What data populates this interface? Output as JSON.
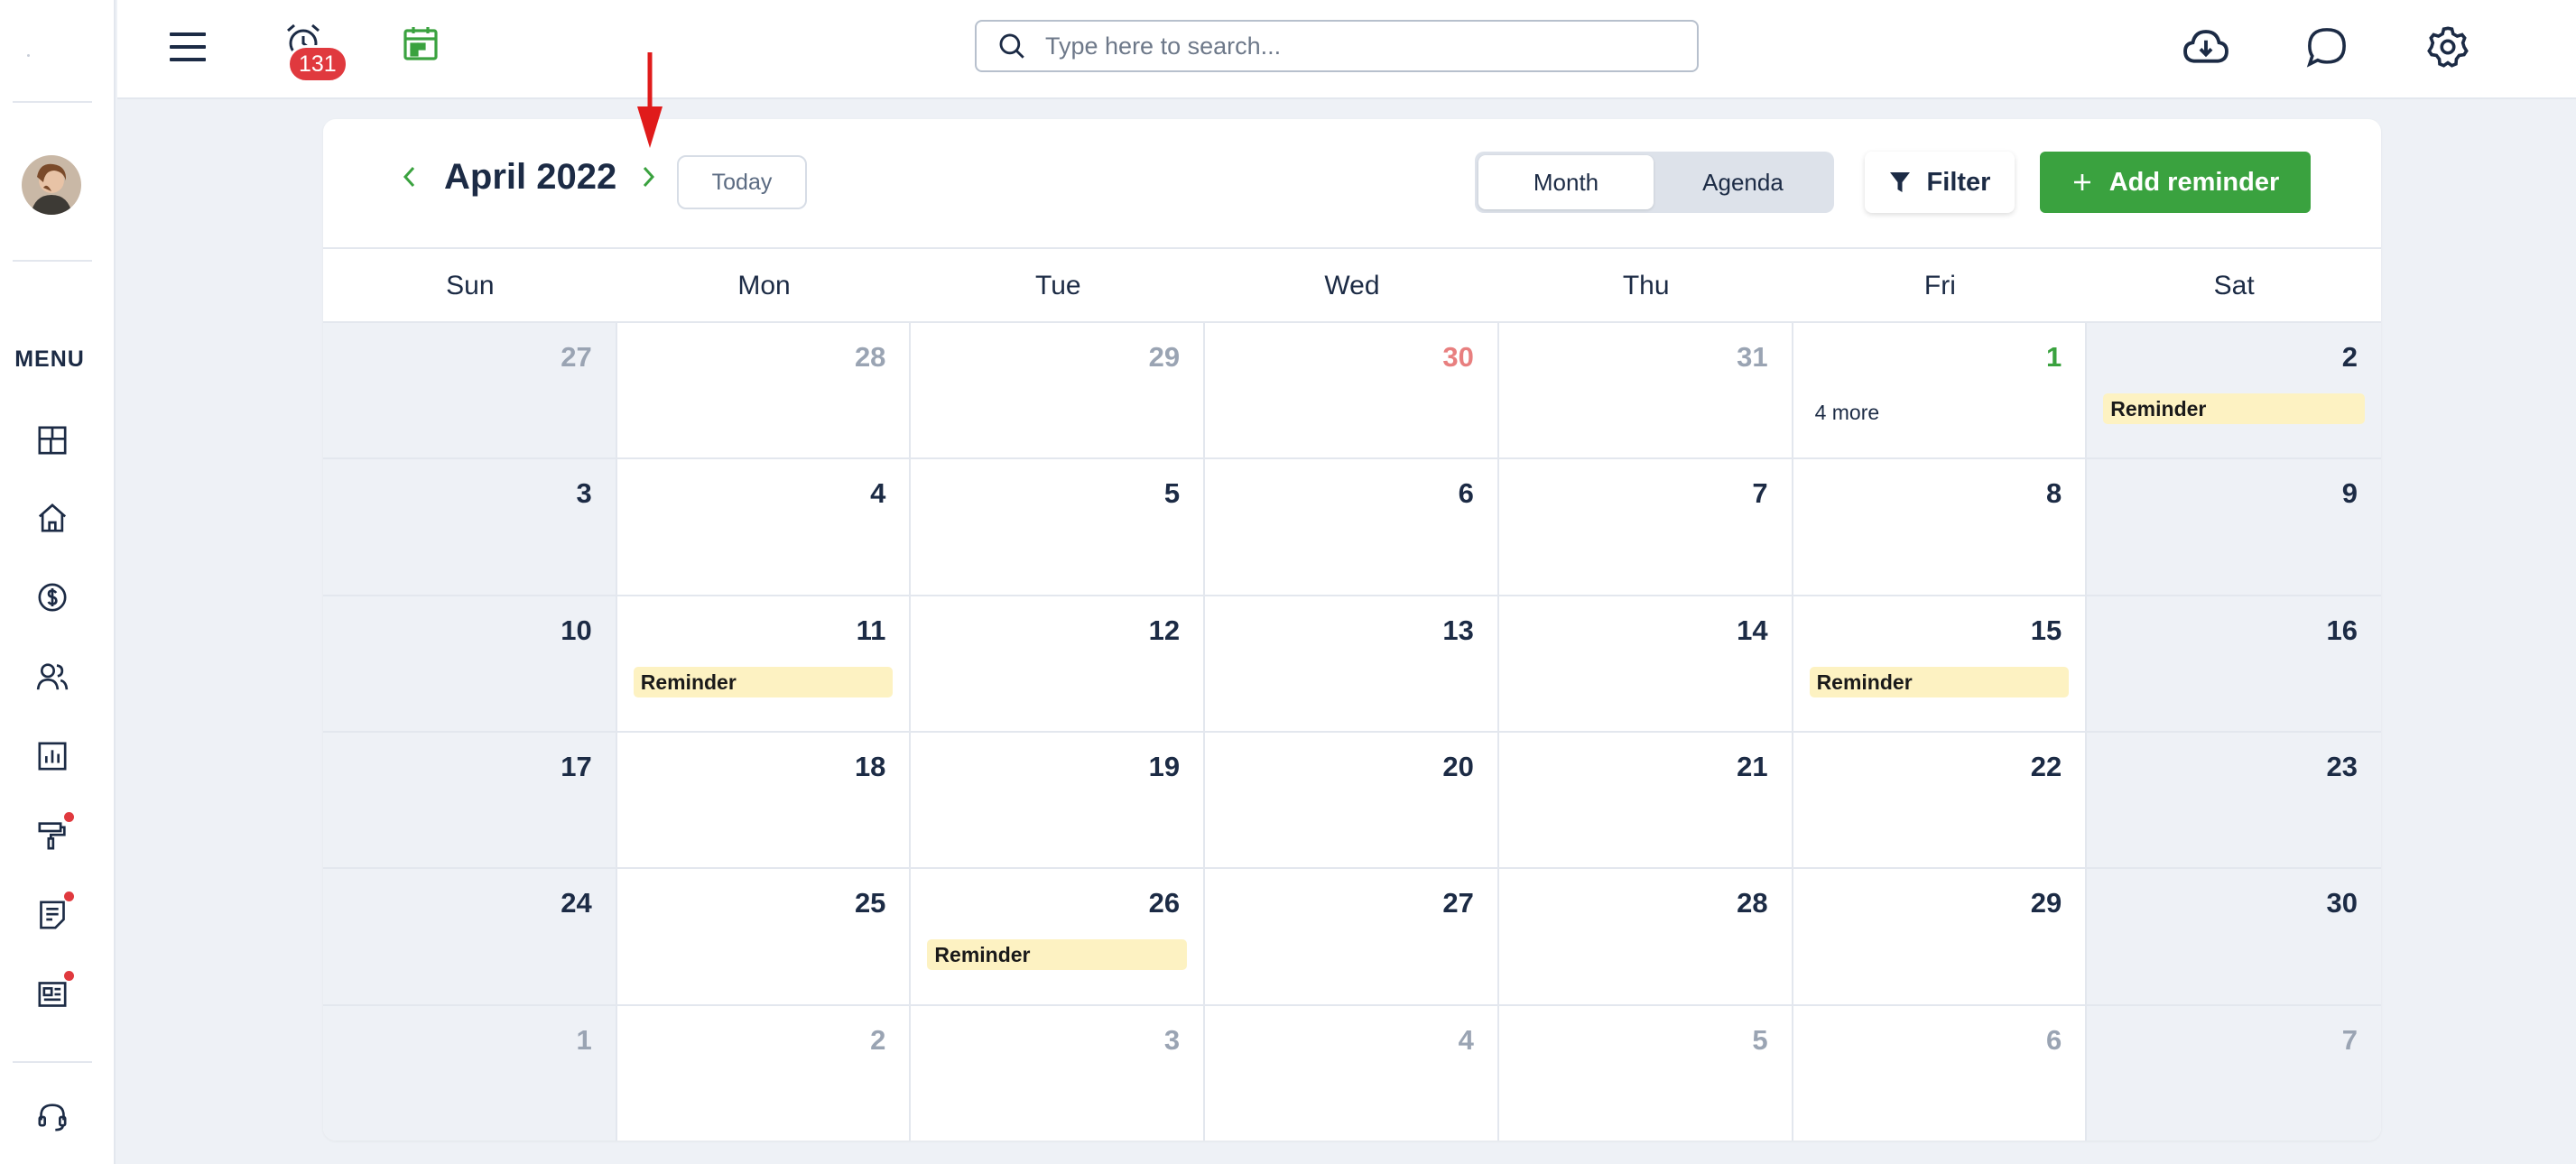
{
  "sidebar": {
    "menu_label": "MENU",
    "items": [
      {
        "name": "dashboard",
        "icon": "dashboard-icon"
      },
      {
        "name": "home",
        "icon": "home-icon"
      },
      {
        "name": "billing",
        "icon": "dollar-icon"
      },
      {
        "name": "clients",
        "icon": "users-icon"
      },
      {
        "name": "reports",
        "icon": "chart-icon"
      },
      {
        "name": "tools",
        "icon": "paint-roller-icon",
        "dot": true
      },
      {
        "name": "documents",
        "icon": "document-icon",
        "dot": true
      },
      {
        "name": "news",
        "icon": "newspaper-icon",
        "dot": true
      },
      {
        "name": "support",
        "icon": "headset-icon"
      }
    ]
  },
  "topbar": {
    "alarm_count": "131",
    "search_placeholder": "Type here to search..."
  },
  "calendar": {
    "month_title": "April 2022",
    "today_label": "Today",
    "view_options": [
      "Month",
      "Agenda"
    ],
    "active_view": "Month",
    "filter_label": "Filter",
    "add_label": "Add reminder",
    "weekdays": [
      "Sun",
      "Mon",
      "Tue",
      "Wed",
      "Thu",
      "Fri",
      "Sat"
    ],
    "weeks": [
      [
        {
          "d": "27",
          "s": "muted"
        },
        {
          "d": "28",
          "s": "muted"
        },
        {
          "d": "29",
          "s": "muted"
        },
        {
          "d": "30",
          "s": "red"
        },
        {
          "d": "31",
          "s": "muted"
        },
        {
          "d": "1",
          "s": "green",
          "more": "4 more"
        },
        {
          "d": "2",
          "ev": "Reminder"
        }
      ],
      [
        {
          "d": "3"
        },
        {
          "d": "4"
        },
        {
          "d": "5"
        },
        {
          "d": "6"
        },
        {
          "d": "7"
        },
        {
          "d": "8"
        },
        {
          "d": "9"
        }
      ],
      [
        {
          "d": "10"
        },
        {
          "d": "11",
          "ev": "Reminder"
        },
        {
          "d": "12"
        },
        {
          "d": "13"
        },
        {
          "d": "14"
        },
        {
          "d": "15",
          "ev": "Reminder"
        },
        {
          "d": "16"
        }
      ],
      [
        {
          "d": "17"
        },
        {
          "d": "18"
        },
        {
          "d": "19"
        },
        {
          "d": "20"
        },
        {
          "d": "21"
        },
        {
          "d": "22"
        },
        {
          "d": "23"
        }
      ],
      [
        {
          "d": "24"
        },
        {
          "d": "25"
        },
        {
          "d": "26",
          "ev": "Reminder"
        },
        {
          "d": "27"
        },
        {
          "d": "28"
        },
        {
          "d": "29"
        },
        {
          "d": "30"
        }
      ],
      [
        {
          "d": "1",
          "s": "muted"
        },
        {
          "d": "2",
          "s": "muted"
        },
        {
          "d": "3",
          "s": "muted"
        },
        {
          "d": "4",
          "s": "muted"
        },
        {
          "d": "5",
          "s": "muted"
        },
        {
          "d": "6",
          "s": "muted"
        },
        {
          "d": "7",
          "s": "muted"
        }
      ]
    ]
  },
  "colors": {
    "accent": "#3aa23f",
    "badge": "#e0393e",
    "event_bg": "#fdf2c2",
    "weekend_bg": "#eef1f6",
    "annotation": "#e01b1b"
  }
}
